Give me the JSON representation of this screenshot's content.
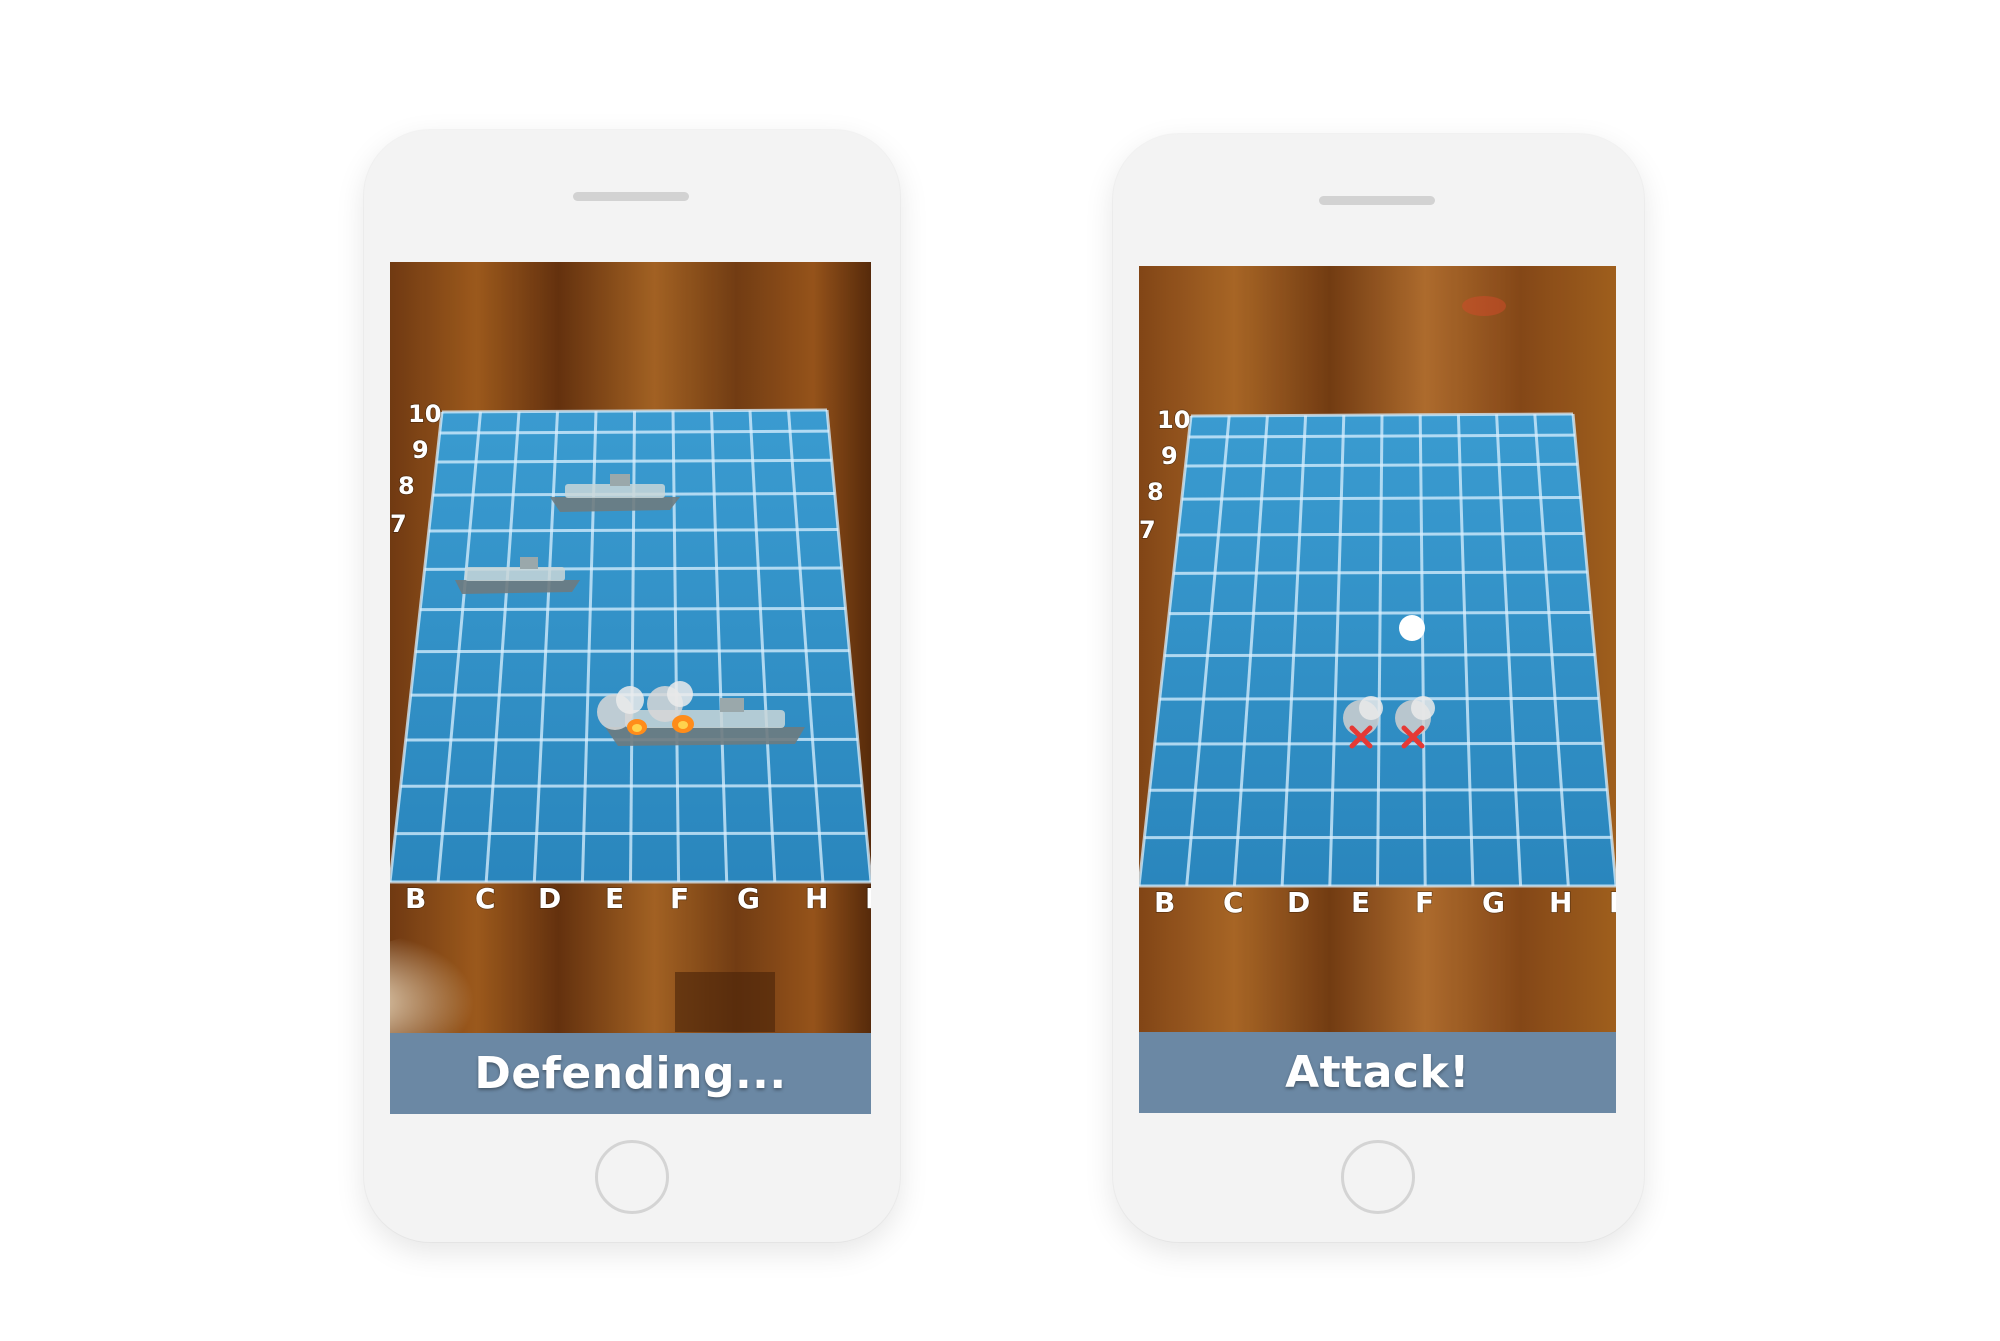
{
  "screens": [
    {
      "status": "Defending...",
      "column_labels": [
        "B",
        "C",
        "D",
        "E",
        "F",
        "G",
        "H",
        "I"
      ],
      "row_labels": [
        "10",
        "9",
        "8",
        "7"
      ]
    },
    {
      "status": "Attack!",
      "column_labels": [
        "B",
        "C",
        "D",
        "E",
        "F",
        "G",
        "H",
        "I"
      ],
      "row_labels": [
        "10",
        "9",
        "8",
        "7"
      ]
    }
  ],
  "colors": {
    "phone_body": "#f3f3f3",
    "status_bar": "#6b88a4",
    "water": "#2e8fc4",
    "grid_lines": "#d9f0ff",
    "wood": "#8a4a1a",
    "hit_marker": "#e53935",
    "miss_marker": "#ffffff"
  },
  "icons": [
    "ship-icon",
    "smoke-icon",
    "fire-icon",
    "hit-marker-icon",
    "miss-marker-icon",
    "home-button-icon"
  ]
}
